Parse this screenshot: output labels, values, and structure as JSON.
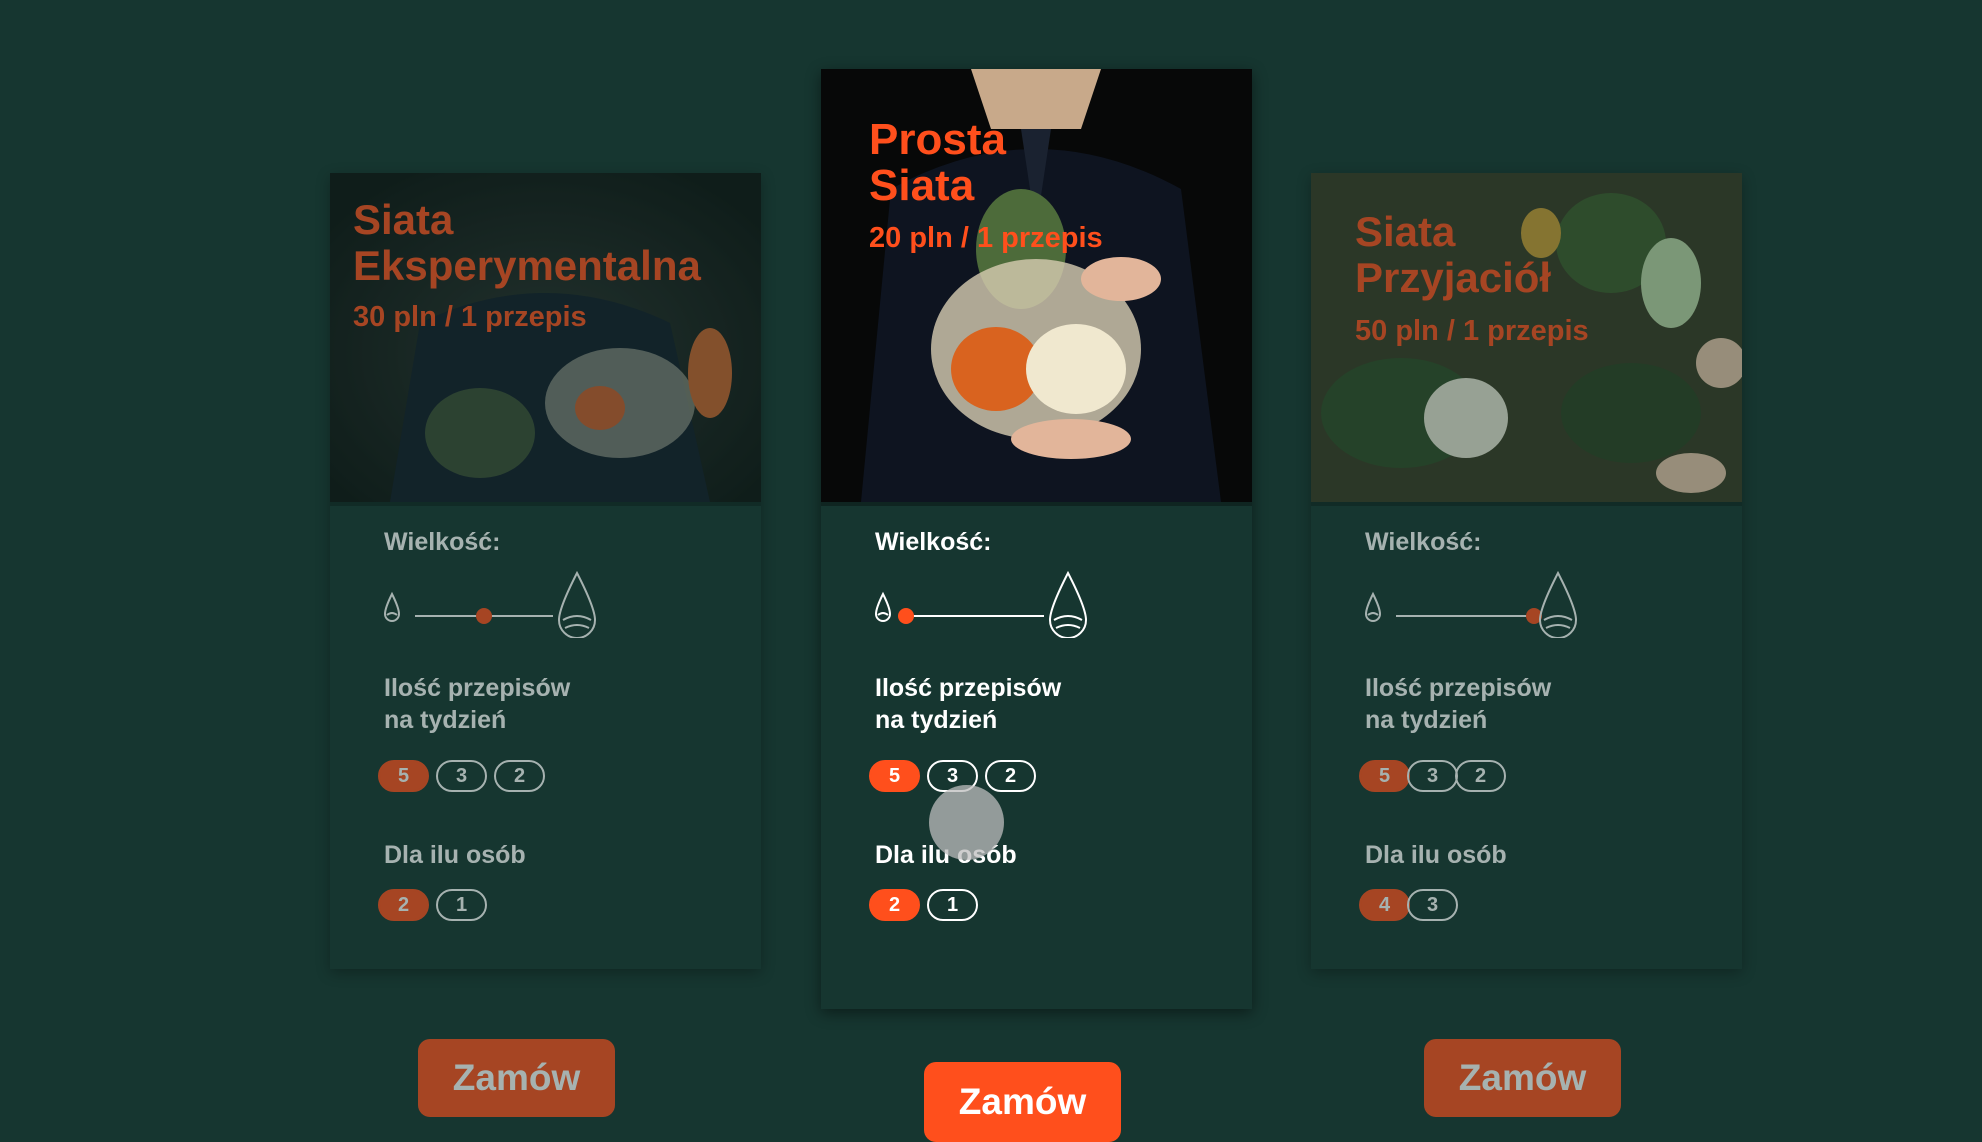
{
  "cards": [
    {
      "title": "Siata\nEksperymentalna",
      "price": "30 pln / 1 przepis",
      "size_label": "Wielkość:",
      "size_level": 0.5,
      "recipes_label": "Ilość przepisów\nna tydzień",
      "recipes_options": [
        "5",
        "3",
        "2"
      ],
      "recipes_selected": "5",
      "people_label": "Dla ilu osób",
      "people_options": [
        "2",
        "1"
      ],
      "people_selected": "2",
      "order_label": "Zamów"
    },
    {
      "title": "Prosta\nSiata",
      "price": "20 pln / 1 przepis",
      "size_label": "Wielkość:",
      "size_level": 0.0,
      "recipes_label": "Ilość przepisów\nna tydzień",
      "recipes_options": [
        "5",
        "3",
        "2"
      ],
      "recipes_selected": "5",
      "people_label": "Dla ilu osób",
      "people_options": [
        "2",
        "1"
      ],
      "people_selected": "2",
      "order_label": "Zamów"
    },
    {
      "title": "Siata\nPrzyjaciół",
      "price": "50 pln / 1 przepis",
      "size_label": "Wielkość:",
      "size_level": 1.0,
      "recipes_label": "Ilość przepisów\nna tydzień",
      "recipes_options": [
        "5",
        "3",
        "2"
      ],
      "recipes_selected": "5",
      "people_label": "Dla ilu osób",
      "people_options": [
        "4",
        "3"
      ],
      "people_selected": "4",
      "order_label": "Zamów"
    }
  ],
  "colors": {
    "background": "#163630",
    "accent": "#ff4f1c",
    "text": "#ffffff"
  },
  "icons": {
    "size_small": "drop-small-icon",
    "size_large": "drop-large-icon"
  }
}
